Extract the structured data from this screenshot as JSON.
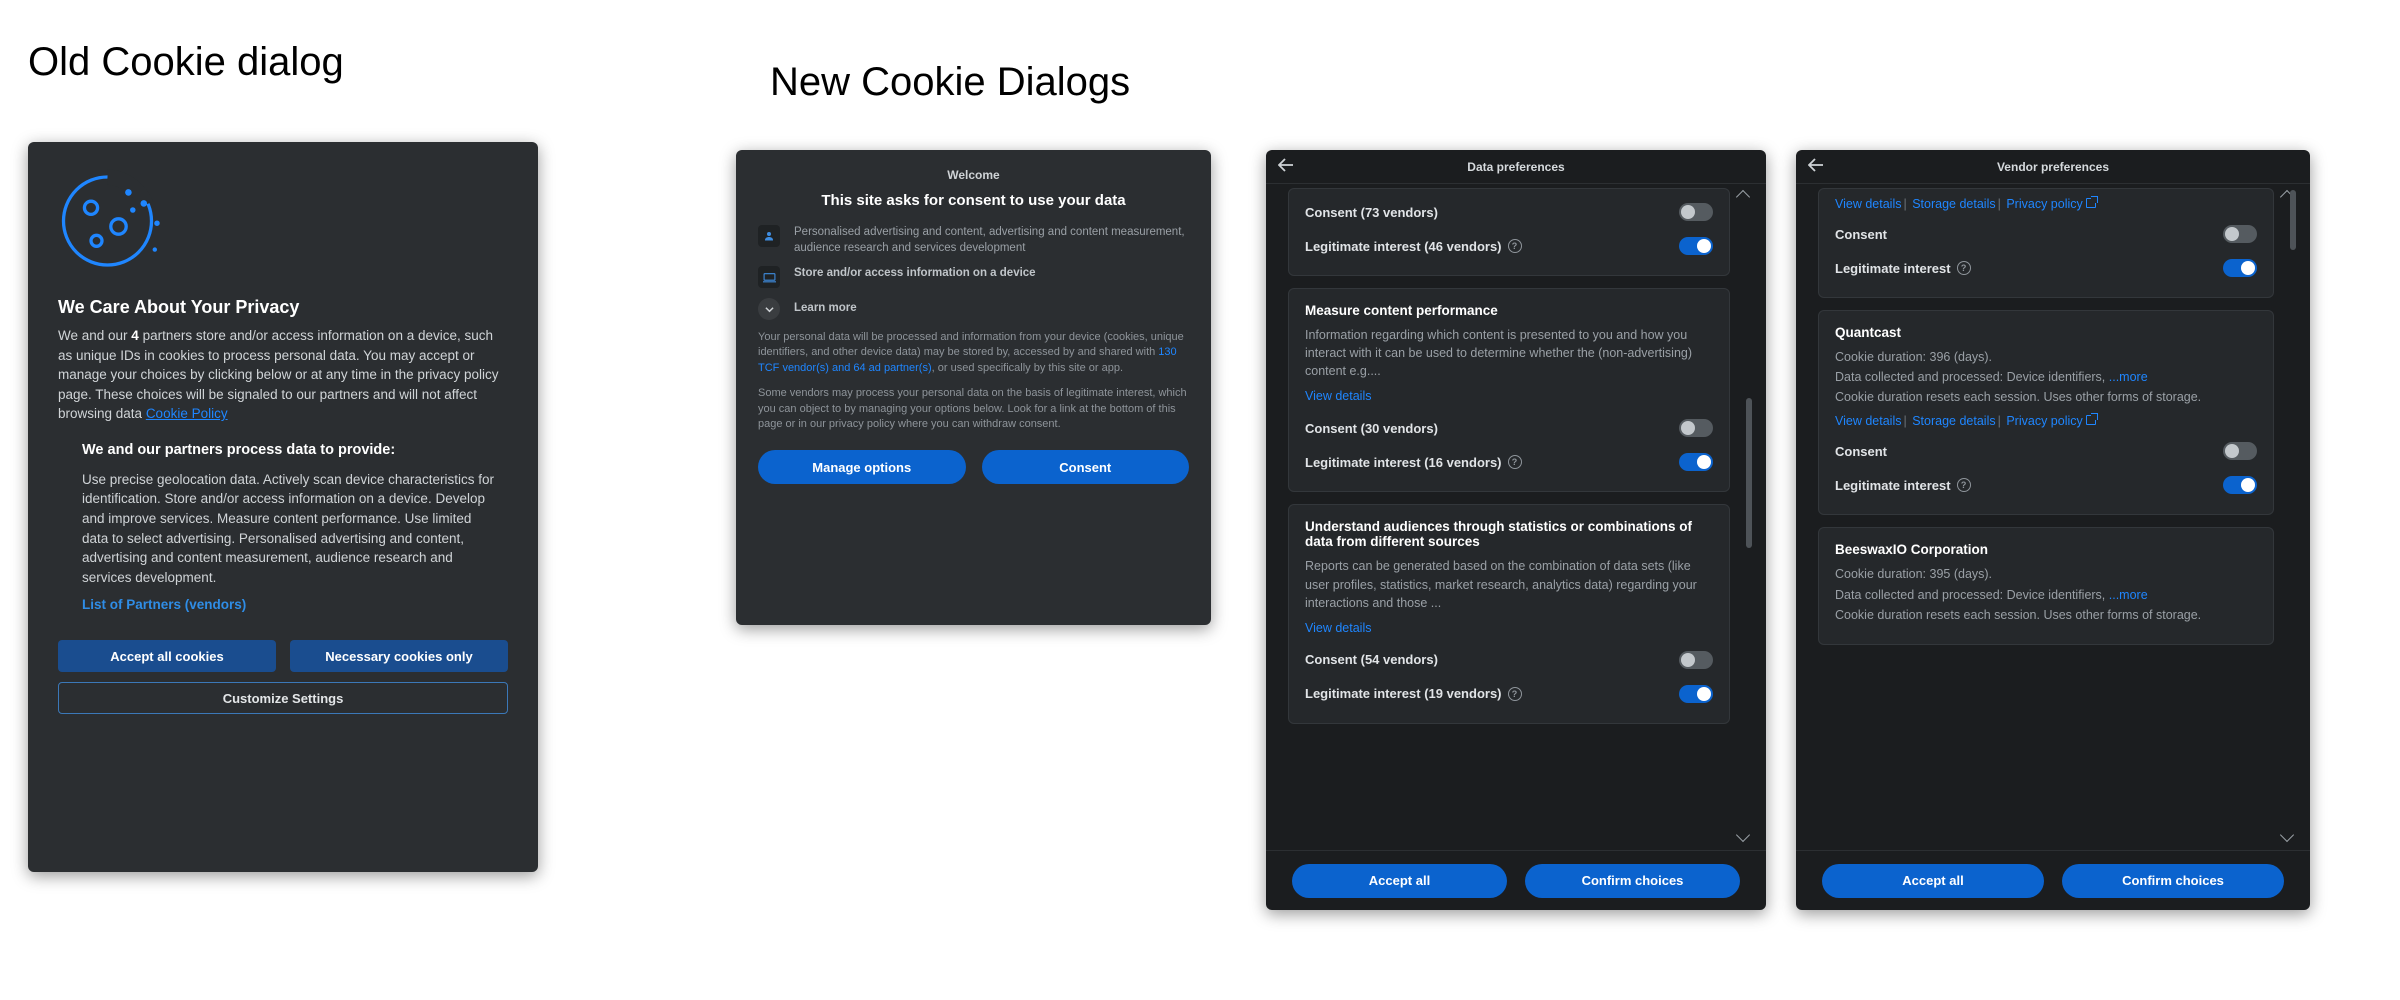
{
  "labels": {
    "old_heading": "Old Cookie dialog",
    "new_heading": "New Cookie Dialogs"
  },
  "old": {
    "title": "We Care About Your Privacy",
    "body_pre": "We and our ",
    "body_partner_count": "4",
    "body_post": " partners store and/or access information on a device, such as unique IDs in cookies to process personal data. You may accept or manage your choices by clicking below or at any time in the privacy policy page. These choices will be signaled to our partners and will not affect browsing data ",
    "cookie_policy_link": "Cookie Policy",
    "subheading": "We and our partners process data to provide:",
    "body2": "Use precise geolocation data. Actively scan device characteristics for identification. Store and/or access information on a device. Develop and improve services. Measure content performance. Use limited data to select advertising. Personalised advertising and content, advertising and content measurement, audience research and services development.",
    "partners_link": "List of Partners (vendors)",
    "accept_btn": "Accept all cookies",
    "necessary_btn": "Necessary cookies only",
    "customize_btn": "Customize Settings"
  },
  "welcome": {
    "eyebrow": "Welcome",
    "title": "This site asks for consent to use your data",
    "row1": "Personalised advertising and content, advertising and content measurement, audience research and services development",
    "row2": "Store and/or access information on a device",
    "learn_more": "Learn more",
    "para1_pre": "Your personal data will be processed and information from your device (cookies, unique identifiers, and other device data) may be stored by, accessed by and shared with ",
    "vendor_link": "130 TCF vendor(s) and 64 ad partner(s)",
    "para1_post": ", or used specifically by this site or app.",
    "para2": "Some vendors may process your personal data on the basis of legitimate interest, which you can object to by managing your options below. Look for a link at the bottom of this page or in our privacy policy where you can withdraw consent.",
    "manage_btn": "Manage options",
    "consent_btn": "Consent"
  },
  "dataprefs": {
    "title": "Data preferences",
    "top": {
      "consent_label": "Consent (73 vendors)",
      "li_label": "Legitimate interest (46 vendors)"
    },
    "card_measure": {
      "title": "Measure content performance",
      "desc": "Information regarding which content is presented to you and how you interact with it can be used to determine whether the (non-advertising) content e.g....",
      "view_details": "View details",
      "consent_label": "Consent (30 vendors)",
      "li_label": "Legitimate interest (16 vendors)"
    },
    "card_understand": {
      "title": "Understand audiences through statistics or combinations of data from different sources",
      "desc": "Reports can be generated based on the combination of data sets (like user profiles, statistics, market research, analytics data) regarding your interactions and those ...",
      "view_details": "View details",
      "consent_label": "Consent (54 vendors)",
      "li_label": "Legitimate interest (19 vendors)"
    },
    "accept_btn": "Accept all",
    "confirm_btn": "Confirm choices"
  },
  "vendor": {
    "title": "Vendor preferences",
    "links": {
      "view": "View details",
      "storage": "Storage details",
      "privacy": "Privacy policy"
    },
    "row": {
      "consent": "Consent",
      "li": "Legitimate interest"
    },
    "quantcast": {
      "name": "Quantcast",
      "duration": "Cookie duration: 396 (days).",
      "collected_pre": "Data collected and processed: Device identifiers, ",
      "more": "...more",
      "reset": "Cookie duration resets each session. Uses other forms of storage."
    },
    "beeswax": {
      "name": "BeeswaxIO Corporation",
      "duration": "Cookie duration: 395 (days).",
      "collected_pre": "Data collected and processed: Device identifiers, ",
      "more": "...more",
      "reset": "Cookie duration resets each session. Uses other forms of storage."
    },
    "accept_btn": "Accept all",
    "confirm_btn": "Confirm choices"
  }
}
